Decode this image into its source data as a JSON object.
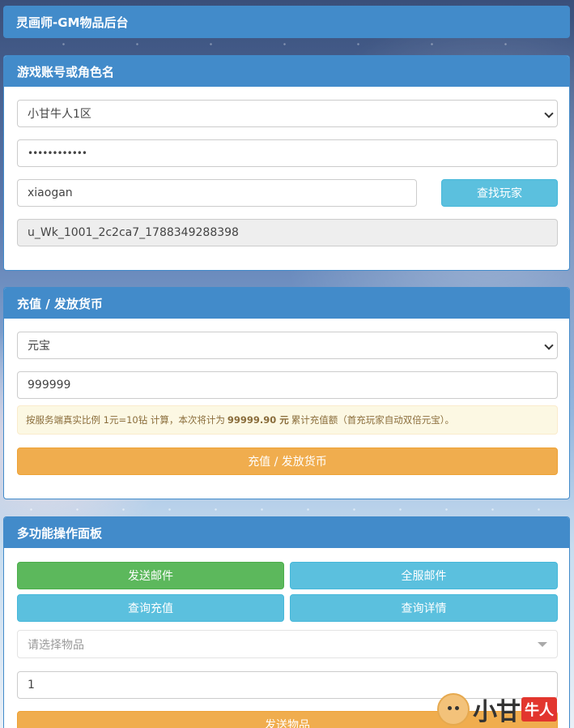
{
  "header": {
    "title": "灵画师-GM物品后台"
  },
  "account_panel": {
    "title": "游戏账号或角色名",
    "server_select": "小甘牛人1区",
    "password_value": "••••••••••••",
    "username_value": "xiaogan",
    "find_player_label": "查找玩家",
    "player_id": "u_Wk_1001_2c2ca7_1788349288398"
  },
  "recharge_panel": {
    "title": "充值 / 发放货币",
    "currency_select": "元宝",
    "amount_value": "999999",
    "notice_prefix": "按服务端真实比例 1元=10钻 计算，本次将计为",
    "notice_amount": "99999.90 元",
    "notice_suffix": "累计充值额（首充玩家自动双倍元宝）。",
    "submit_label": "充值 / 发放货币"
  },
  "multi_panel": {
    "title": "多功能操作面板",
    "send_mail_label": "发送邮件",
    "server_mail_label": "全服邮件",
    "query_recharge_label": "查询充值",
    "query_detail_label": "查询详情",
    "item_select_placeholder": "请选择物品",
    "quantity_value": "1",
    "send_item_label": "发送物品"
  },
  "watermark": {
    "text_main": "小甘",
    "text_badge": "牛人"
  },
  "colors": {
    "primary": "#428bca",
    "info": "#5bc0de",
    "warning": "#f0ad4e",
    "success": "#5cb85c"
  }
}
